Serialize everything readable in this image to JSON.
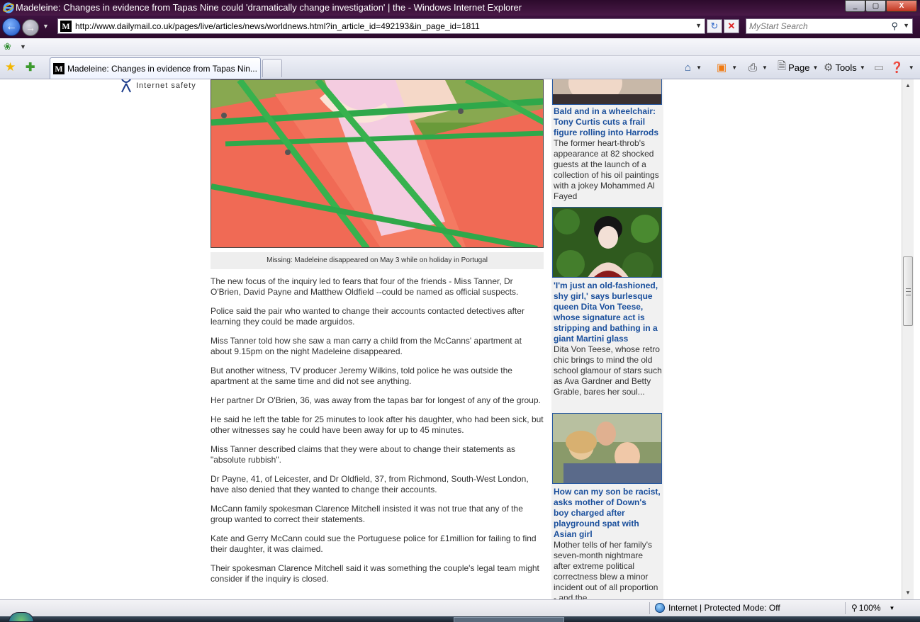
{
  "window": {
    "title": "Madeleine: Changes in evidence from Tapas Nine could 'dramatically change investigation' | the  - Windows Internet Explorer",
    "minimize": "_",
    "maximize": "▢",
    "close": "X"
  },
  "addressbar": {
    "url": "http://www.dailymail.co.uk/pages/live/articles/news/worldnews.html?in_article_id=492193&in_page_id=1811",
    "favicon": "M"
  },
  "search": {
    "placeholder": "MyStart Search"
  },
  "tab": {
    "label": "Madeleine: Changes in evidence from Tapas Nin...",
    "favicon": "M"
  },
  "commandbar": {
    "page_label": "Page",
    "tools_label": "Tools"
  },
  "page": {
    "logo_text": "Internet safety",
    "caption": "Missing: Madeleine disappeared on May 3 while on holiday in Portugal",
    "paragraphs": [
      "The new focus of the inquiry led to fears that four of the friends - Miss Tanner, Dr O'Brien, David Payne and Matthew Oldfield --could be named as official suspects.",
      "Police said the pair who wanted to change their accounts contacted detectives after learning they could be made arguidos.",
      "Miss Tanner told how she saw a man carry a child from the McCanns' apartment at about 9.15pm on the night Madeleine disappeared.",
      "But another witness, TV producer Jeremy Wilkins, told police he was outside the apartment at the same time and did not see anything.",
      "Her partner Dr O'Brien, 36, was away from the tapas bar for longest of any of the group.",
      "He said he left the table for 25 minutes to look after his daughter, who had been sick, but other witnesses say he could have been away for up to 45 minutes.",
      "Miss Tanner described claims that they were about to change their statements as \"absolute rubbish\".",
      "Dr Payne, 41, of Leicester, and Dr Oldfield, 37, from Richmond, South-West London, have also denied that they wanted to change their accounts.",
      "McCann family spokesman Clarence Mitchell insisted it was not true that any of the group wanted to correct their statements.",
      "Kate and Gerry McCann could sue the Portuguese police for £1million for failing to find their daughter, it was claimed.",
      "Their spokesman Clarence Mitchell said it was something the couple's legal team might consider if the inquiry is closed."
    ]
  },
  "sidebar": {
    "items": [
      {
        "headline": "Bald and in a wheelchair: Tony Curtis cuts a frail figure rolling into Harrods",
        "body": "The former heart-throb's appearance at 82 shocked guests at the launch of a collection of his oil paintings with a jokey Mohammed Al Fayed"
      },
      {
        "headline": "'I'm just an old-fashioned, shy girl,' says burlesque queen Dita Von Teese, whose signature act is stripping and bathing in a giant Martini glass",
        "body": "Dita Von Teese, whose retro chic brings to mind the old school glamour of stars such as Ava Gardner and Betty Grable, bares her soul..."
      },
      {
        "headline": "How can my son be racist, asks mother of Down's boy charged after playground spat with Asian girl",
        "body": "Mother tells of her family's seven-month nightmare after extreme political correctness blew a minor incident out of all proportion - and the"
      }
    ]
  },
  "statusbar": {
    "zone": "Internet | Protected Mode: Off",
    "zoom": "100%"
  }
}
